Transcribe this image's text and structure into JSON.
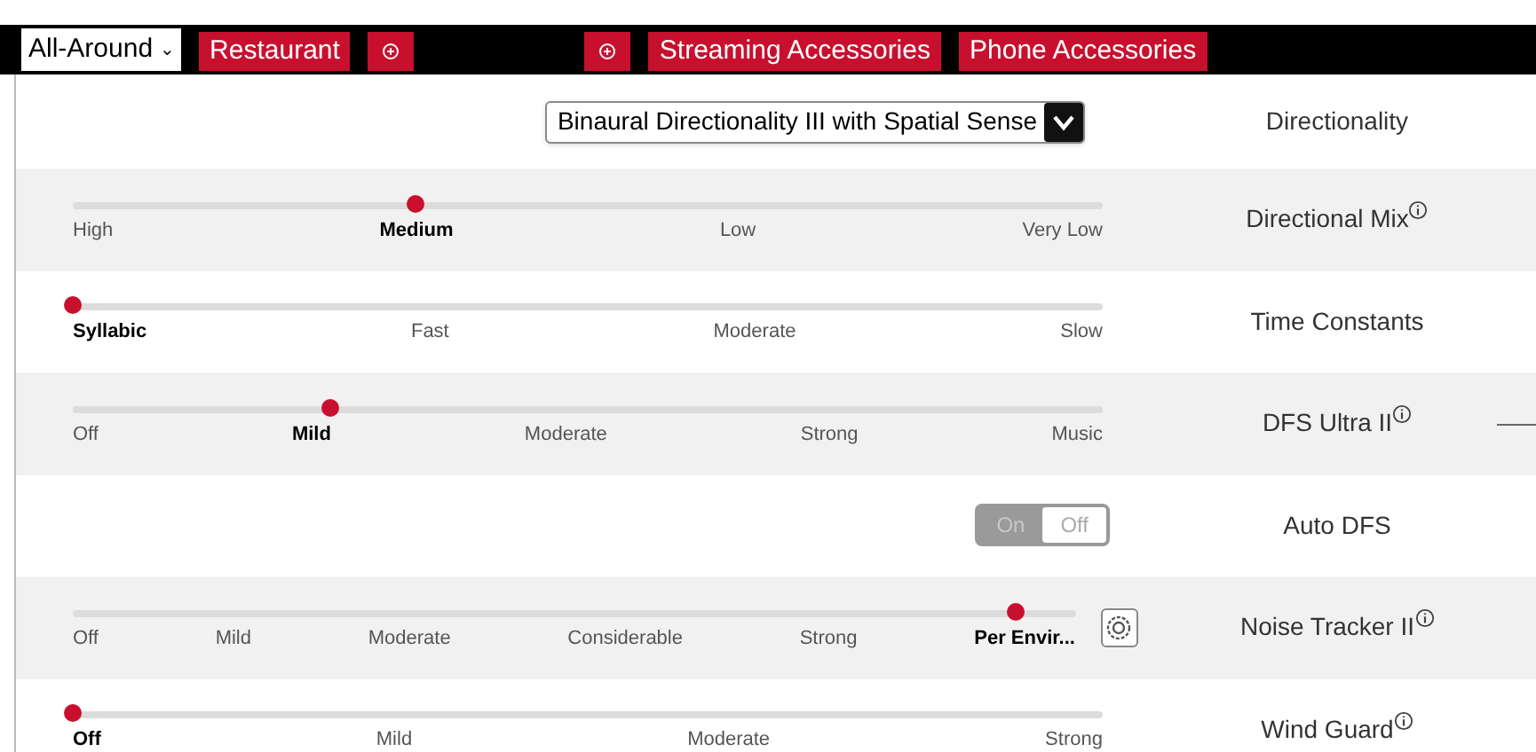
{
  "tabs": [
    {
      "kind": "dropdown",
      "label": "All-Around",
      "caret": "⌄",
      "selected": true
    },
    {
      "kind": "text",
      "label": "Restaurant",
      "selected": false
    },
    {
      "kind": "add",
      "selected": false
    },
    {
      "kind": "add",
      "selected": false
    },
    {
      "kind": "text",
      "label": "Streaming Accessories",
      "selected": false
    },
    {
      "kind": "text",
      "label": "Phone Accessories",
      "selected": false
    }
  ],
  "rows": [
    {
      "kind": "select",
      "label": "Directionality",
      "value": "Binaural Directionality III with Spatial Sense"
    },
    {
      "kind": "slider",
      "label": "Directional Mix",
      "info": true,
      "level": 0.333,
      "options": [
        {
          "label": "High",
          "selected": false
        },
        {
          "label": "Medium",
          "selected": true
        },
        {
          "label": "Low",
          "selected": false
        },
        {
          "label": "Very Low",
          "selected": false
        }
      ]
    },
    {
      "kind": "slider",
      "label": "Time Constants",
      "level": 0,
      "options": [
        {
          "label": "Syllabic",
          "selected": true
        },
        {
          "label": "Fast",
          "selected": false
        },
        {
          "label": "Moderate",
          "selected": false
        },
        {
          "label": "Slow",
          "selected": false
        }
      ]
    },
    {
      "kind": "slider",
      "label": "DFS Ultra II",
      "info": true,
      "level": 0.25,
      "options": [
        {
          "label": "Off",
          "selected": false
        },
        {
          "label": "Mild",
          "selected": true
        },
        {
          "label": "Moderate",
          "selected": false
        },
        {
          "label": "Strong",
          "selected": false
        },
        {
          "label": "Music",
          "selected": false
        }
      ]
    },
    {
      "kind": "toggle",
      "label": "Auto DFS",
      "options": [
        {
          "label": "On",
          "selected": false
        },
        {
          "label": "Off",
          "selected": true
        }
      ]
    },
    {
      "kind": "slider",
      "label": "Noise Tracker II",
      "info": true,
      "gear": true,
      "level": 0.94,
      "options": [
        {
          "label": "Off",
          "selected": false
        },
        {
          "label": "Mild",
          "selected": false
        },
        {
          "label": "Moderate",
          "selected": false
        },
        {
          "label": "Considerable",
          "selected": false
        },
        {
          "label": "Strong",
          "selected": false
        },
        {
          "label": "Per Envir...",
          "selected": true
        }
      ]
    },
    {
      "kind": "slider",
      "label": "Wind Guard",
      "info": true,
      "level": 0,
      "options": [
        {
          "label": "Off",
          "selected": true
        },
        {
          "label": "Mild",
          "selected": false
        },
        {
          "label": "Moderate",
          "selected": false
        },
        {
          "label": "Strong",
          "selected": false
        }
      ]
    }
  ]
}
